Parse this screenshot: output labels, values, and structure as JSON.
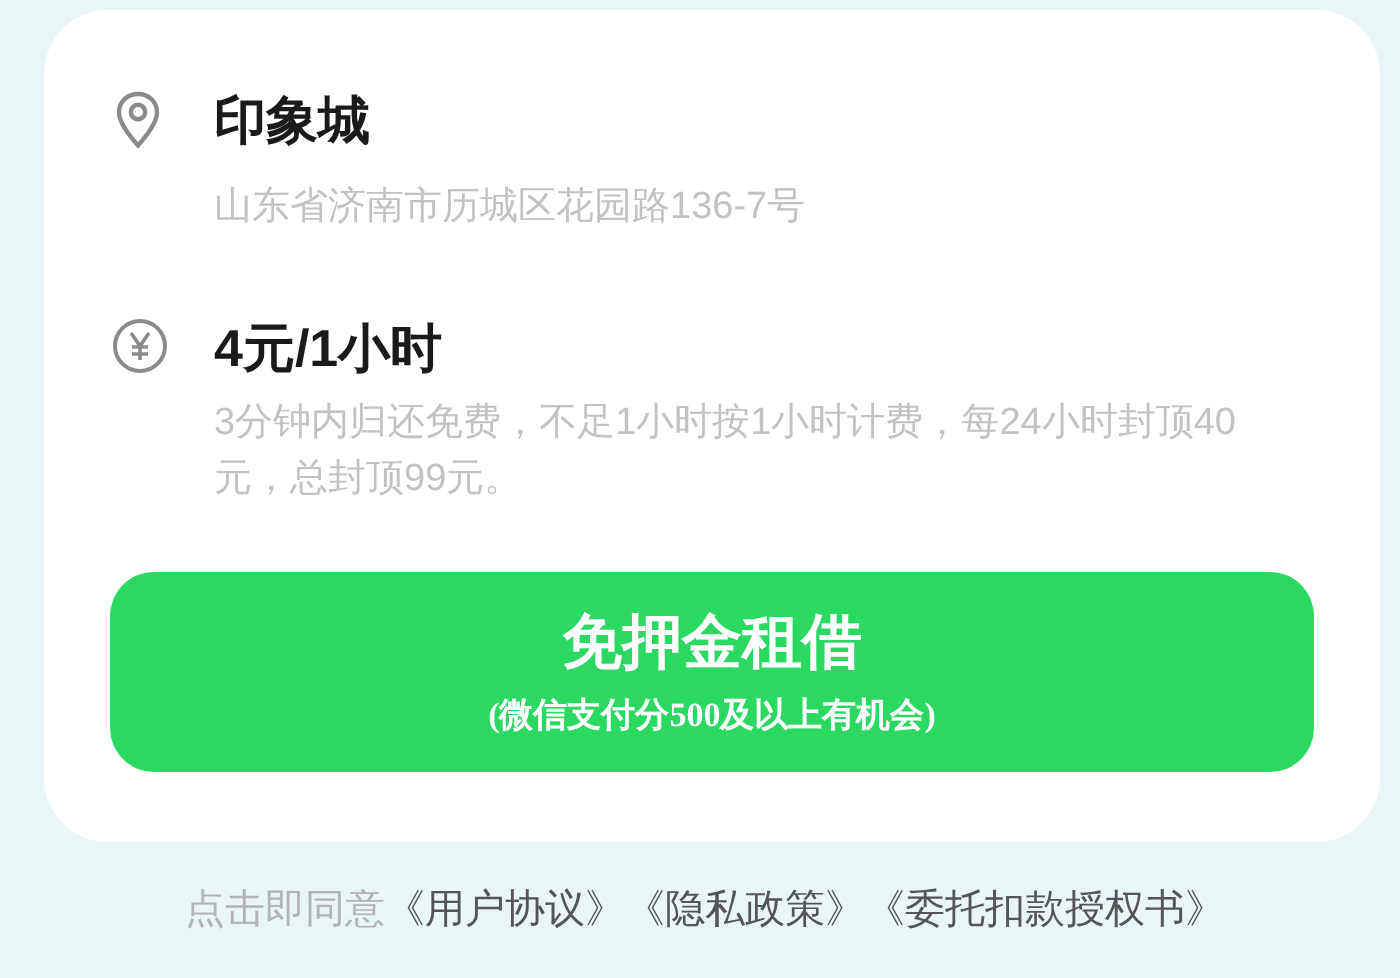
{
  "location": {
    "name": "印象城",
    "address": "山东省济南市历城区花园路136-7号"
  },
  "price": {
    "title": "4元/1小时",
    "description": "3分钟内归还免费，不足1小时按1小时计费，每24小时封顶40元，总封顶99元。"
  },
  "rent_button": {
    "title": "免押金租借",
    "subtitle": "(微信支付分500及以上有机会)"
  },
  "agreement": {
    "prefix": "点击即同意",
    "links": [
      "《用户协议》",
      "《隐私政策》",
      "《委托扣款授权书》"
    ]
  }
}
